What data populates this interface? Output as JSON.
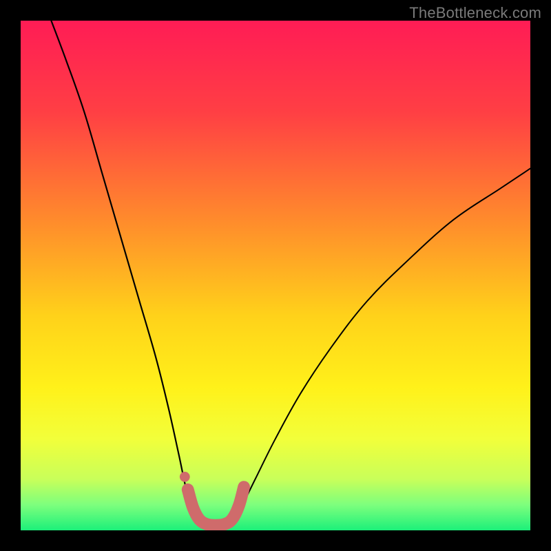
{
  "watermark": {
    "text": "TheBottleneck.com"
  },
  "colors": {
    "frame_bg": "#000000",
    "curve_stroke": "#000000",
    "marker_fill": "#cf6b6b",
    "gradient_stops": [
      {
        "offset": 0.0,
        "color": "#ff1c55"
      },
      {
        "offset": 0.18,
        "color": "#ff3f44"
      },
      {
        "offset": 0.4,
        "color": "#ff8e2b"
      },
      {
        "offset": 0.58,
        "color": "#ffd21a"
      },
      {
        "offset": 0.72,
        "color": "#fff11a"
      },
      {
        "offset": 0.82,
        "color": "#f2ff3a"
      },
      {
        "offset": 0.9,
        "color": "#c8ff5a"
      },
      {
        "offset": 0.95,
        "color": "#7dff7d"
      },
      {
        "offset": 1.0,
        "color": "#1cf07a"
      }
    ]
  },
  "chart_data": {
    "type": "line",
    "title": "",
    "xlabel": "",
    "ylabel": "",
    "xlim": [
      0,
      100
    ],
    "ylim": [
      0,
      100
    ],
    "note": "Axes are unlabeled in the source image; values below are pixel-space samples of the two visible curves and the marker segment, normalized to 0–100 with origin at bottom-left. The heat gradient is decorative background.",
    "series": [
      {
        "name": "left-curve",
        "type": "line",
        "points": [
          {
            "x": 6.0,
            "y": 100.0
          },
          {
            "x": 9.0,
            "y": 92.0
          },
          {
            "x": 12.5,
            "y": 82.0
          },
          {
            "x": 16.0,
            "y": 70.0
          },
          {
            "x": 19.5,
            "y": 58.0
          },
          {
            "x": 23.0,
            "y": 46.0
          },
          {
            "x": 26.5,
            "y": 34.0
          },
          {
            "x": 29.0,
            "y": 24.0
          },
          {
            "x": 31.0,
            "y": 15.0
          },
          {
            "x": 32.5,
            "y": 8.0
          },
          {
            "x": 34.0,
            "y": 3.0
          },
          {
            "x": 35.5,
            "y": 1.0
          }
        ]
      },
      {
        "name": "right-curve",
        "type": "line",
        "points": [
          {
            "x": 41.0,
            "y": 1.0
          },
          {
            "x": 43.0,
            "y": 4.0
          },
          {
            "x": 46.0,
            "y": 10.0
          },
          {
            "x": 50.0,
            "y": 18.0
          },
          {
            "x": 55.0,
            "y": 27.0
          },
          {
            "x": 61.0,
            "y": 36.0
          },
          {
            "x": 68.0,
            "y": 45.0
          },
          {
            "x": 76.0,
            "y": 53.0
          },
          {
            "x": 85.0,
            "y": 61.0
          },
          {
            "x": 94.0,
            "y": 67.0
          },
          {
            "x": 100.0,
            "y": 71.0
          }
        ]
      },
      {
        "name": "bottom-marker",
        "type": "marker-path",
        "stroke_width_pct": 2.4,
        "lead_dot": {
          "x": 32.2,
          "y": 10.5,
          "r_pct": 1.0
        },
        "points": [
          {
            "x": 32.8,
            "y": 8.0
          },
          {
            "x": 33.8,
            "y": 4.5
          },
          {
            "x": 35.0,
            "y": 2.2
          },
          {
            "x": 36.5,
            "y": 1.2
          },
          {
            "x": 38.2,
            "y": 1.0
          },
          {
            "x": 40.0,
            "y": 1.2
          },
          {
            "x": 41.5,
            "y": 2.2
          },
          {
            "x": 42.8,
            "y": 4.8
          },
          {
            "x": 43.8,
            "y": 8.5
          }
        ]
      }
    ]
  }
}
